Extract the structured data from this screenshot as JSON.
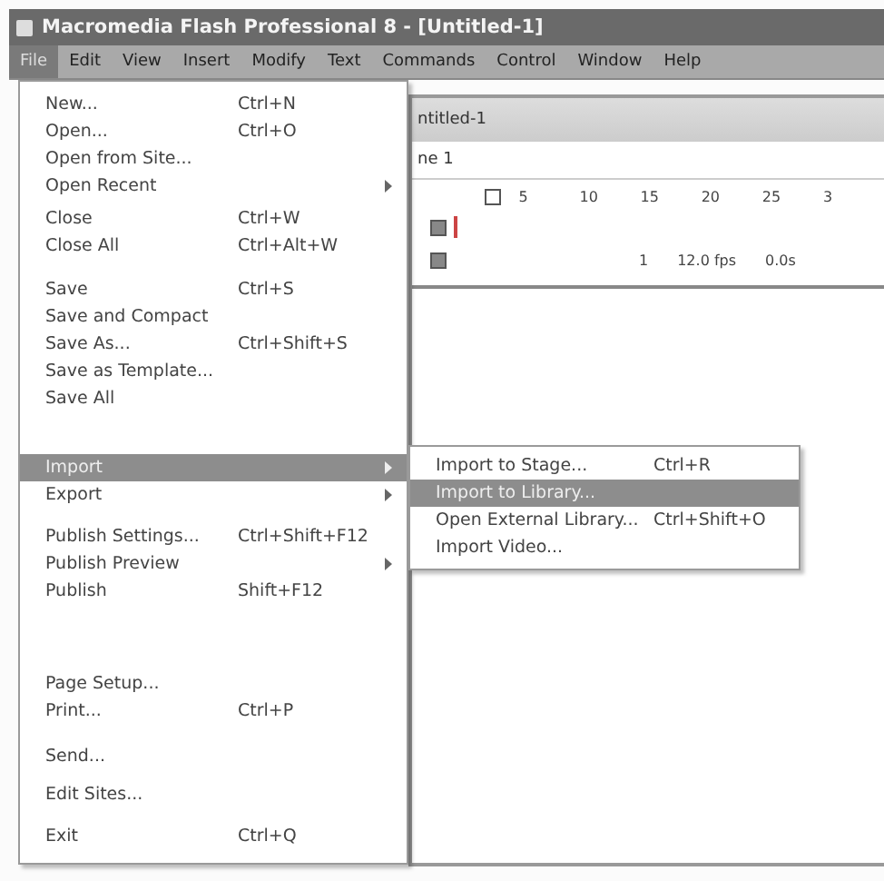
{
  "window": {
    "title": "Macromedia Flash Professional 8 - [Untitled-1]"
  },
  "menubar": [
    {
      "label": "File",
      "selected": true
    },
    {
      "label": "Edit",
      "selected": false
    },
    {
      "label": "View",
      "selected": false
    },
    {
      "label": "Insert",
      "selected": false
    },
    {
      "label": "Modify",
      "selected": false
    },
    {
      "label": "Text",
      "selected": false
    },
    {
      "label": "Commands",
      "selected": false
    },
    {
      "label": "Control",
      "selected": false
    },
    {
      "label": "Window",
      "selected": false
    },
    {
      "label": "Help",
      "selected": false
    }
  ],
  "file_menu": [
    {
      "kind": "item",
      "label": "New...",
      "shortcut": "Ctrl+N",
      "submenu": false,
      "selected": false
    },
    {
      "kind": "item",
      "label": "Open...",
      "shortcut": "Ctrl+O",
      "submenu": false,
      "selected": false
    },
    {
      "kind": "item",
      "label": "Open from Site...",
      "submenu": false,
      "selected": false
    },
    {
      "kind": "item",
      "label": "Open Recent",
      "submenu": true,
      "selected": false
    },
    {
      "kind": "separator"
    },
    {
      "kind": "item",
      "label": "Close",
      "shortcut": "Ctrl+W",
      "submenu": false,
      "selected": false
    },
    {
      "kind": "item",
      "label": "Close All",
      "shortcut": "Ctrl+Alt+W",
      "submenu": false,
      "selected": false
    },
    {
      "kind": "separator"
    },
    {
      "kind": "item",
      "label": "Save",
      "shortcut": "Ctrl+S",
      "submenu": false,
      "selected": false
    },
    {
      "kind": "item",
      "label": "Save and Compact",
      "submenu": false,
      "selected": false
    },
    {
      "kind": "item",
      "label": "Save As...",
      "shortcut": "Ctrl+Shift+S",
      "submenu": false,
      "selected": false
    },
    {
      "kind": "item",
      "label": "Save as Template...",
      "submenu": false,
      "selected": false
    },
    {
      "kind": "item",
      "label": "Save All",
      "submenu": false,
      "selected": false
    },
    {
      "kind": "separator"
    },
    {
      "kind": "item",
      "label": "Import",
      "submenu": true,
      "selected": true
    },
    {
      "kind": "item",
      "label": "Export",
      "submenu": true,
      "selected": false
    },
    {
      "kind": "separator"
    },
    {
      "kind": "item",
      "label": "Publish Settings...",
      "shortcut": "Ctrl+Shift+F12",
      "submenu": false,
      "selected": false
    },
    {
      "kind": "item",
      "label": "Publish Preview",
      "submenu": true,
      "selected": false
    },
    {
      "kind": "item",
      "label": "Publish",
      "shortcut": "Shift+F12",
      "submenu": false,
      "selected": false
    },
    {
      "kind": "separator"
    },
    {
      "kind": "item",
      "label": "Page Setup...",
      "submenu": false,
      "selected": false
    },
    {
      "kind": "item",
      "label": "Print...",
      "shortcut": "Ctrl+P",
      "submenu": false,
      "selected": false
    },
    {
      "kind": "separator"
    },
    {
      "kind": "item",
      "label": "Send...",
      "submenu": false,
      "selected": false
    },
    {
      "kind": "separator"
    },
    {
      "kind": "item",
      "label": "Edit Sites...",
      "submenu": false,
      "selected": false
    },
    {
      "kind": "separator"
    },
    {
      "kind": "item",
      "label": "Exit",
      "shortcut": "Ctrl+Q",
      "submenu": false,
      "selected": false
    }
  ],
  "import_submenu": [
    {
      "label": "Import to Stage...",
      "shortcut": "Ctrl+R",
      "selected": false
    },
    {
      "label": "Import to Library...",
      "selected": true
    },
    {
      "label": "Open External Library...",
      "shortcut": "Ctrl+Shift+O",
      "selected": false
    },
    {
      "label": "Import Video...",
      "selected": false
    }
  ],
  "document": {
    "tab": "ntitled-1",
    "scene": "ne 1",
    "frame_numbers": [
      "5",
      "10",
      "15",
      "20",
      "25",
      "3"
    ],
    "status": [
      "1",
      "12.0 fps",
      "0.0s"
    ]
  }
}
